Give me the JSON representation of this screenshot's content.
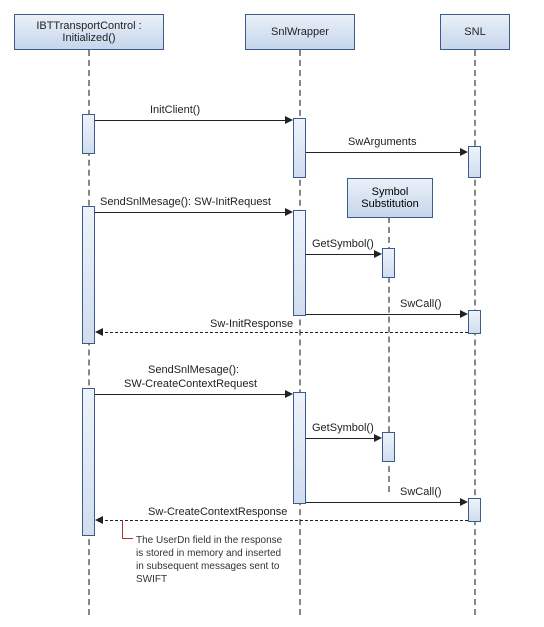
{
  "lifelines": {
    "ibt": {
      "title": "IBTTransportControl : Initialized()"
    },
    "snlwrapper": {
      "title": "SnlWrapper"
    },
    "snl": {
      "title": "SNL"
    }
  },
  "messages": {
    "init_client": "InitClient()",
    "sw_arguments": "SwArguments",
    "send_init": "SendSnlMesage(): SW-InitRequest",
    "get_symbol_1": "GetSymbol()",
    "sw_call_1": "SwCall()",
    "init_response": "Sw-InitResponse",
    "send_create": "SendSnlMesage(): SW-CreateContextRequest",
    "send_create_l1": "SendSnlMesage():",
    "send_create_l2": "SW-CreateContextRequest",
    "get_symbol_2": "GetSymbol()",
    "sw_call_2": "SwCall()",
    "create_response": "Sw-CreateContextResponse"
  },
  "notes": {
    "symbol_sub": "Symbol Substitution"
  },
  "footnote": "The UserDn field in the response is stored in memory and inserted in subsequent messages sent to SWIFT",
  "chart_data": {
    "type": "sequence-diagram",
    "lifelines": [
      "IBTTransportControl : Initialized()",
      "SnlWrapper",
      "SNL"
    ],
    "interactions": [
      {
        "from": "IBTTransportControl",
        "to": "SnlWrapper",
        "label": "InitClient()",
        "style": "solid"
      },
      {
        "from": "SnlWrapper",
        "to": "SNL",
        "label": "SwArguments",
        "style": "solid"
      },
      {
        "note_over": "SnlWrapper/SNL",
        "text": "Symbol Substitution"
      },
      {
        "from": "IBTTransportControl",
        "to": "SnlWrapper",
        "label": "SendSnlMesage(): SW-InitRequest",
        "style": "solid"
      },
      {
        "from": "SnlWrapper",
        "to": "SymbolSubstitution",
        "label": "GetSymbol()",
        "style": "solid"
      },
      {
        "from": "SnlWrapper",
        "to": "SNL",
        "label": "SwCall()",
        "style": "solid"
      },
      {
        "from": "SNL",
        "to": "IBTTransportControl",
        "label": "Sw-InitResponse",
        "style": "dashed"
      },
      {
        "from": "IBTTransportControl",
        "to": "SnlWrapper",
        "label": "SendSnlMesage(): SW-CreateContextRequest",
        "style": "solid"
      },
      {
        "from": "SnlWrapper",
        "to": "SymbolSubstitution",
        "label": "GetSymbol()",
        "style": "solid"
      },
      {
        "from": "SnlWrapper",
        "to": "SNL",
        "label": "SwCall()",
        "style": "solid"
      },
      {
        "from": "SNL",
        "to": "IBTTransportControl",
        "label": "Sw-CreateContextResponse",
        "style": "dashed",
        "footnote": "The UserDn field in the response is stored in memory and inserted in subsequent messages sent to SWIFT"
      }
    ]
  }
}
